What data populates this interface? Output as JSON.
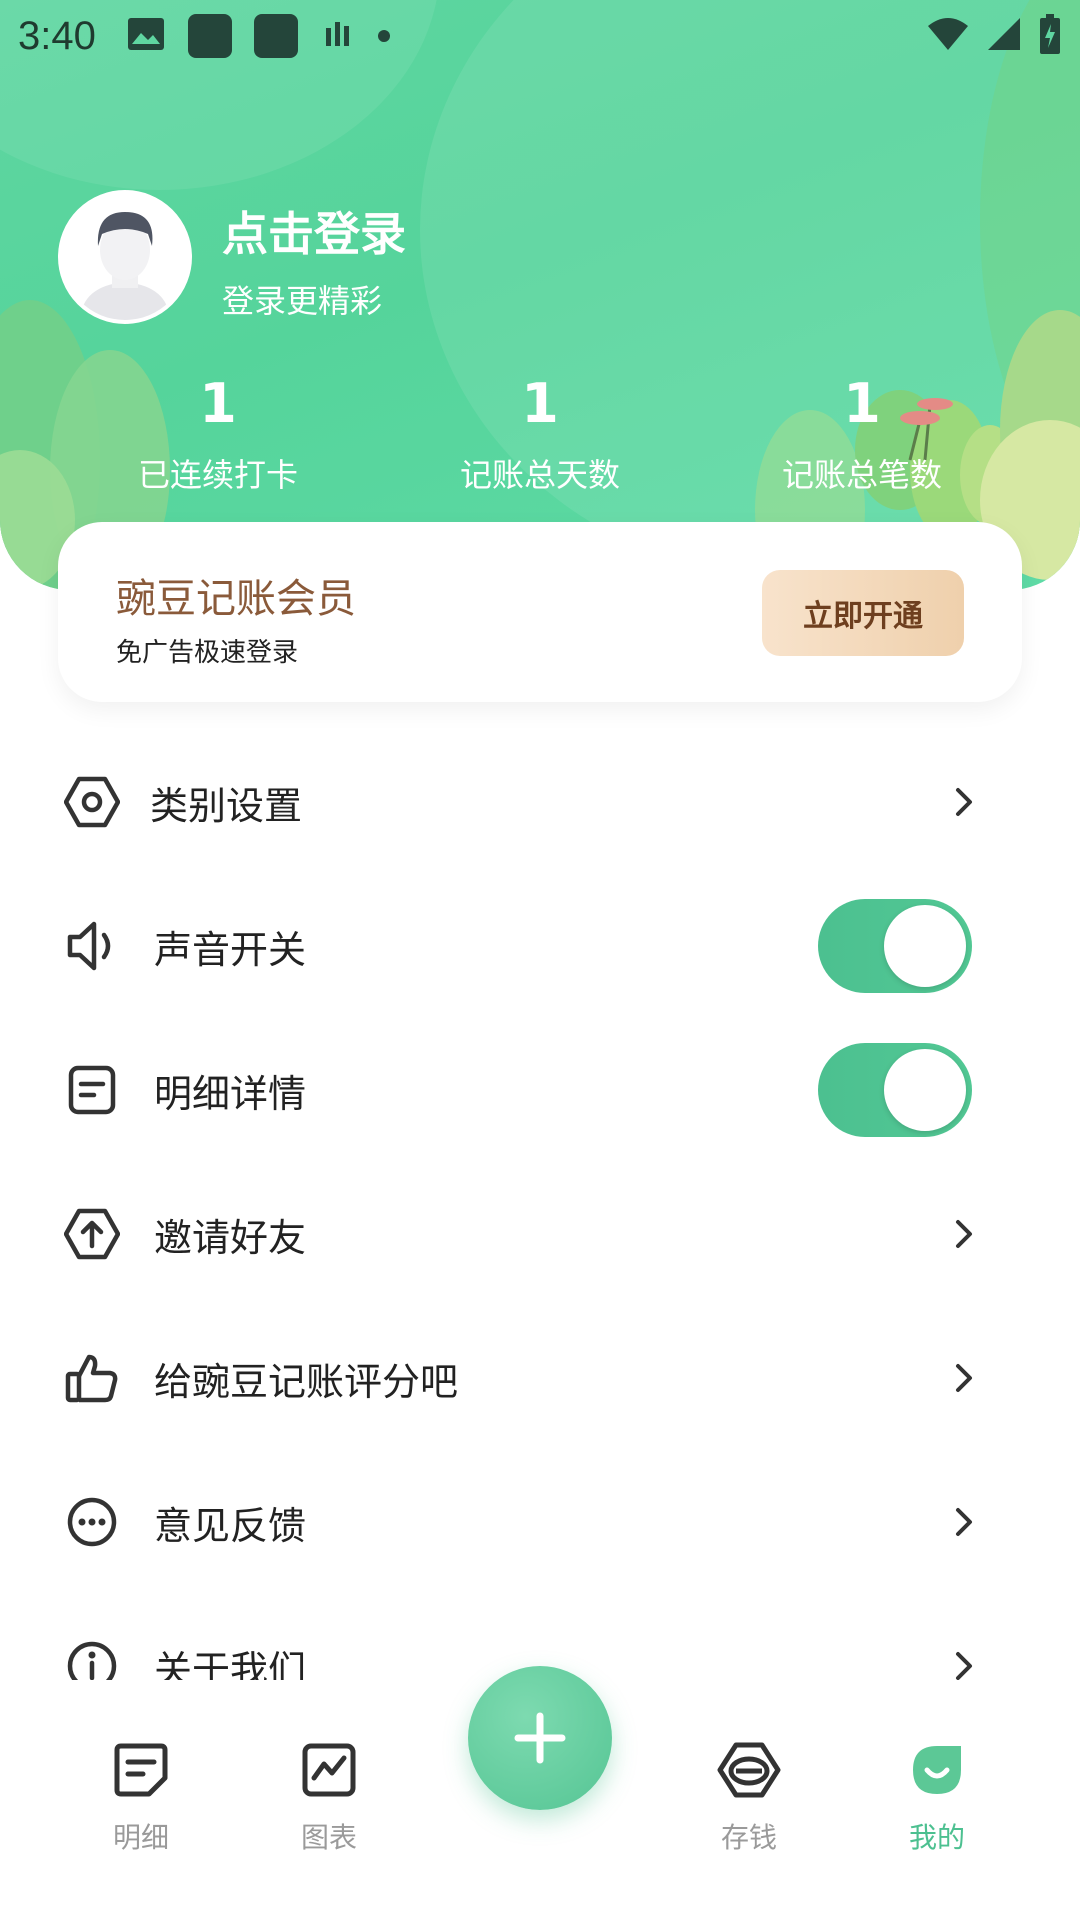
{
  "status_bar": {
    "time": "3:40"
  },
  "profile": {
    "title": "点击登录",
    "subtitle": "登录更精彩"
  },
  "stats": [
    {
      "value": "1",
      "label": "已连续打卡"
    },
    {
      "value": "1",
      "label": "记账总天数"
    },
    {
      "value": "1",
      "label": "记账总笔数"
    }
  ],
  "member": {
    "title": "豌豆记账会员",
    "subtitle": "免广告极速登录",
    "button": "立即开通"
  },
  "menu": [
    {
      "label": "类别设置",
      "icon": "hexagon-settings-icon",
      "control": "chevron"
    },
    {
      "label": "声音开关",
      "icon": "speaker-icon",
      "control": "toggle",
      "on": true
    },
    {
      "label": "明细详情",
      "icon": "document-icon",
      "control": "toggle",
      "on": true
    },
    {
      "label": "邀请好友",
      "icon": "share-upload-icon",
      "control": "chevron"
    },
    {
      "label": "给豌豆记账评分吧",
      "icon": "thumbs-up-icon",
      "control": "chevron"
    },
    {
      "label": "意见反馈",
      "icon": "chat-bubble-icon",
      "control": "chevron"
    },
    {
      "label": "关于我们",
      "icon": "info-icon",
      "control": "chevron"
    }
  ],
  "bottom_nav": [
    {
      "label": "明细",
      "icon": "notes-icon",
      "active": false
    },
    {
      "label": "图表",
      "icon": "chart-icon",
      "active": false
    },
    {
      "label": "存钱",
      "icon": "piggy-bank-icon",
      "active": false
    },
    {
      "label": "我的",
      "icon": "profile-smile-icon",
      "active": true
    }
  ],
  "colors": {
    "accent": "#4cc090",
    "header": "#55d49b",
    "member_title": "#8a5a3a",
    "member_button": "#f3d9bb"
  }
}
